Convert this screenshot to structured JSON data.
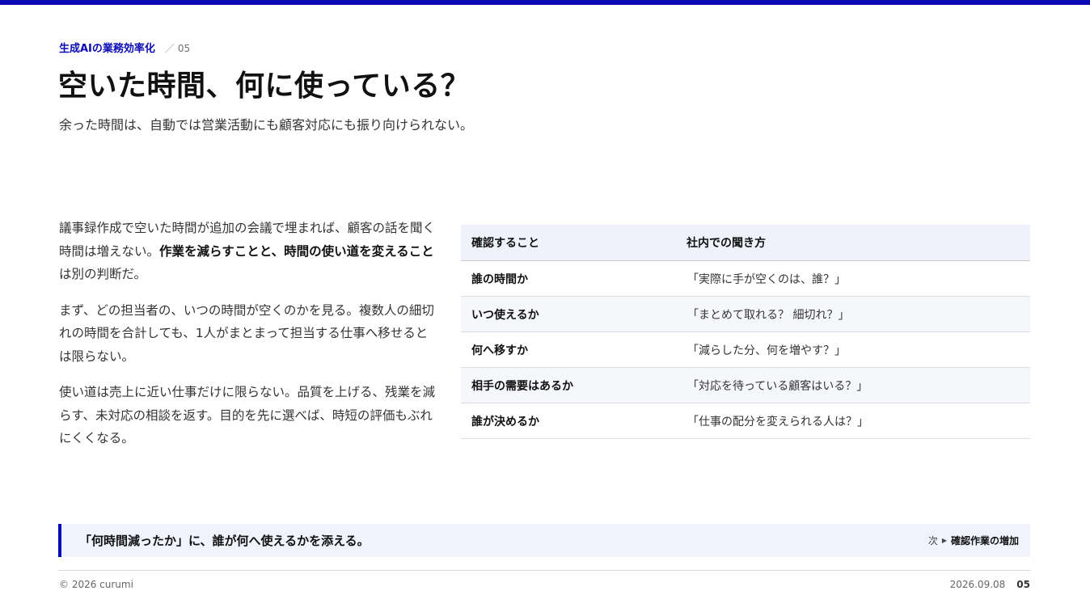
{
  "header": {
    "section": "生成AIの業務効率化",
    "slash": "／",
    "number": "05",
    "title": "空いた時間、何に使っている？",
    "subtitle": "余った時間は、自動では営業活動にも顧客対応にも振り向けられない。"
  },
  "body": {
    "p1": {
      "before": "議事録作成で空いた時間が追加の会議で埋まれば、顧客の話を聞く時間は増えない。",
      "strong": "作業を減らすことと、時間の使い道を変えること",
      "after": "は別の判断だ。"
    },
    "p2": "まず、どの担当者の、いつの時間が空くのかを見る。複数人の細切れの時間を合計しても、1人がまとまって担当する仕事へ移せるとは限らない。",
    "p3": "使い道は売上に近い仕事だけに限らない。品質を上げる、残業を減らす、未対応の相談を返す。目的を先に選べば、時短の評価もぶれにくくなる。"
  },
  "table": {
    "headers": [
      "確認すること",
      "社内での聞き方"
    ],
    "rows": [
      {
        "q": "誰の時間か",
        "a": "「実際に手が空くのは、誰？」"
      },
      {
        "q": "いつ使えるか",
        "a": "「まとめて取れる？ 細切れ？」"
      },
      {
        "q": "何へ移すか",
        "a": "「減らした分、何を増やす？」"
      },
      {
        "q": "相手の需要はあるか",
        "a": "「対応を待っている顧客はいる？」"
      },
      {
        "q": "誰が決めるか",
        "a": "「仕事の配分を変えられる人は？」"
      }
    ]
  },
  "callout": {
    "message": "「何時間減ったか」に、誰が何へ使えるかを添える。",
    "next_label": "次",
    "next_arrow": "▶",
    "next_target": "確認作業の増加"
  },
  "footer": {
    "copyright": "© 2026 curumi",
    "date": "2026.09.08",
    "page": "05"
  },
  "colors": {
    "accent": "#0a0ab5",
    "table_header_bg": "#f0f2fb",
    "callout_bg": "#f0f2fc"
  }
}
